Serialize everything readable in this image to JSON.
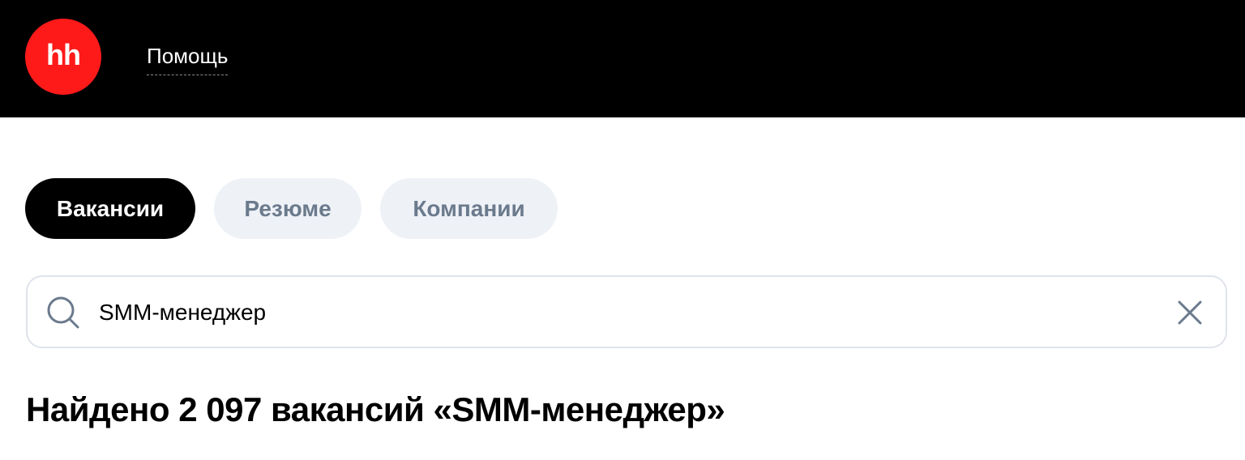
{
  "header": {
    "logo_text": "hh",
    "help_label": "Помощь"
  },
  "tabs": [
    {
      "label": "Вакансии",
      "active": true
    },
    {
      "label": "Резюме",
      "active": false
    },
    {
      "label": "Компании",
      "active": false
    }
  ],
  "search": {
    "value": "SMM-менеджер",
    "search_icon": "search-icon",
    "clear_icon": "close-icon"
  },
  "results": {
    "title": "Найдено 2 097 вакансий «SMM-менеджер»"
  },
  "colors": {
    "header_bg": "#000000",
    "logo_bg": "#ff1a1a",
    "active_tab_bg": "#000000",
    "inactive_tab_bg": "#eef1f6",
    "inactive_tab_text": "#6b7a8d",
    "search_border": "#dfe3ea",
    "icon_color": "#6b7a8d"
  }
}
